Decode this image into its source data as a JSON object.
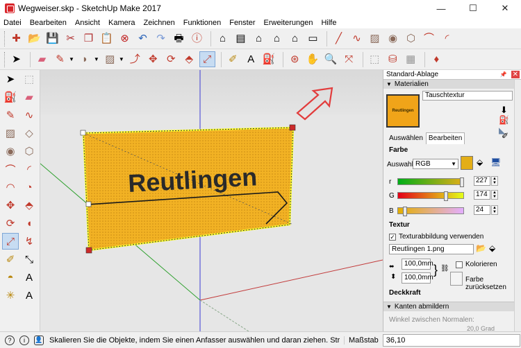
{
  "window": {
    "title": "Wegweiser.skp - SketchUp Make 2017",
    "controls": [
      "—",
      "☐",
      "✕"
    ]
  },
  "menu": [
    "Datei",
    "Bearbeiten",
    "Ansicht",
    "Kamera",
    "Zeichnen",
    "Funktionen",
    "Fenster",
    "Erweiterungen",
    "Hilfe"
  ],
  "toolbar1": [
    "new-file",
    "open-folder",
    "save",
    "cut",
    "copy",
    "paste",
    "erase",
    "undo",
    "redo",
    "print",
    "model-info",
    "iso-view",
    "top-view",
    "front-view",
    "right-view",
    "back-view",
    "left-view",
    "line",
    "arc",
    "rectangle",
    "circle",
    "polygon",
    "freehand",
    "orbit-arc",
    "3pt-arc"
  ],
  "toolbar2": [
    "select",
    "eraser",
    "pencil",
    "arc-dd",
    "shape-dd",
    "push-pull",
    "move",
    "rotate",
    "follow-me",
    "scale",
    "tape-measure",
    "text",
    "paint-bucket",
    "orbit",
    "pan",
    "zoom",
    "zoom-extents",
    "warehouse",
    "extensions",
    "ruby"
  ],
  "left_toolbar": [
    [
      "select",
      "component"
    ],
    [
      "paint",
      "eraser"
    ],
    [
      "line",
      "freehand"
    ],
    [
      "rectangle",
      "rotated-rect"
    ],
    [
      "circle",
      "polygon"
    ],
    [
      "arc",
      "2pt-arc"
    ],
    [
      "3pt-arc",
      "pie"
    ],
    [
      "move",
      "push-pull"
    ],
    [
      "rotate",
      "follow-me"
    ],
    [
      "scale",
      "offset"
    ],
    [
      "tape",
      "dimension"
    ],
    [
      "protractor",
      "text"
    ],
    [
      "axes",
      "3d-text"
    ]
  ],
  "viewport": {
    "sign_text": "Reutlingen"
  },
  "tray": {
    "title": "Standard-Ablage",
    "pin": "📌",
    "close": "✕",
    "materials_header": "Materialien",
    "swatch_text": "Reutlingen",
    "material_name": "Tauschtextur",
    "tabs": [
      "Auswählen",
      "Bearbeiten"
    ],
    "color_label": "Farbe",
    "selector_label": "Auswahl:",
    "selector_value": "RGB",
    "r_label": "r",
    "r_value": "227",
    "g_label": "G",
    "g_value": "174",
    "b_label": "B",
    "b_value": "24",
    "texture_label": "Textur",
    "use_texture_label": "Texturabbildung verwenden",
    "texture_file": "Reutlingen 1.png",
    "width_value": "100,0mm",
    "height_value": "100,0mm",
    "colorize_label": "Kolorieren",
    "reset_color_label": "Farbe zurücksetzen",
    "opacity_label": "Deckkraft",
    "smooth_edges_header": "Kanten abmildern",
    "normals_label": "Winkel zwischen Normalen:",
    "normals_value": "20,0  Grad"
  },
  "colors": {
    "accent": "#e3ae18",
    "viewport_bg": "#e6e6e6",
    "sky": "#dcdcdc"
  },
  "status": {
    "message": "Skalieren Sie die Objekte, indem Sie einen Anfasser auswählen und daran ziehen. Strg = Um...",
    "measure_label": "Maßstab",
    "measure_value": "36,10"
  }
}
